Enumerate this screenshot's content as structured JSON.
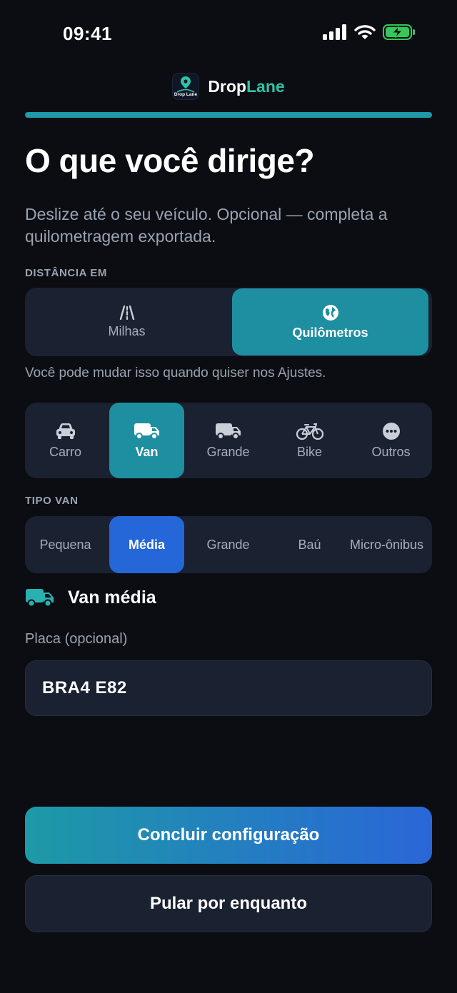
{
  "status_bar": {
    "time": "09:41"
  },
  "brand": {
    "name_main": "Drop",
    "name_accent": "Lane",
    "logo_text": "Drop Lane"
  },
  "onboarding": {
    "progress": 1.0
  },
  "header": {
    "title": "O que você dirige?",
    "subtitle": "Deslize até o seu veículo. Opcional — completa a quilometragem exportada."
  },
  "distance": {
    "section_label": "DISTÂNCIA EM",
    "options": [
      {
        "label": "Milhas",
        "icon": "road-icon",
        "selected": false
      },
      {
        "label": "Quilômetros",
        "icon": "globe-icon",
        "selected": true
      }
    ],
    "hint": "Você pode mudar isso quando quiser nos Ajustes."
  },
  "vehicles": {
    "options": [
      {
        "label": "Carro",
        "icon": "car-icon",
        "selected": false
      },
      {
        "label": "Van",
        "icon": "van-icon",
        "selected": true
      },
      {
        "label": "Grande",
        "icon": "truck-icon",
        "selected": false
      },
      {
        "label": "Bike",
        "icon": "bicycle-icon",
        "selected": false
      },
      {
        "label": "Outros",
        "icon": "more-icon",
        "selected": false
      }
    ]
  },
  "van_type": {
    "section_label": "TIPO VAN",
    "options": [
      {
        "label": "Pequena",
        "selected": false
      },
      {
        "label": "Média",
        "selected": true
      },
      {
        "label": "Grande",
        "selected": false
      },
      {
        "label": "Baú",
        "selected": false
      },
      {
        "label": "Micro-ônibus",
        "selected": false
      }
    ],
    "selected_label": "Van média"
  },
  "plate": {
    "label": "Placa (opcional)",
    "value": "BRA4 E82",
    "placeholder": ""
  },
  "actions": {
    "primary_label": "Concluir configuração",
    "secondary_label": "Pular por enquanto"
  },
  "colors": {
    "accent_teal": "#1e8fa0",
    "accent_blue": "#2566d8",
    "brand_green": "#2ec4a6",
    "battery_green": "#34c759"
  }
}
